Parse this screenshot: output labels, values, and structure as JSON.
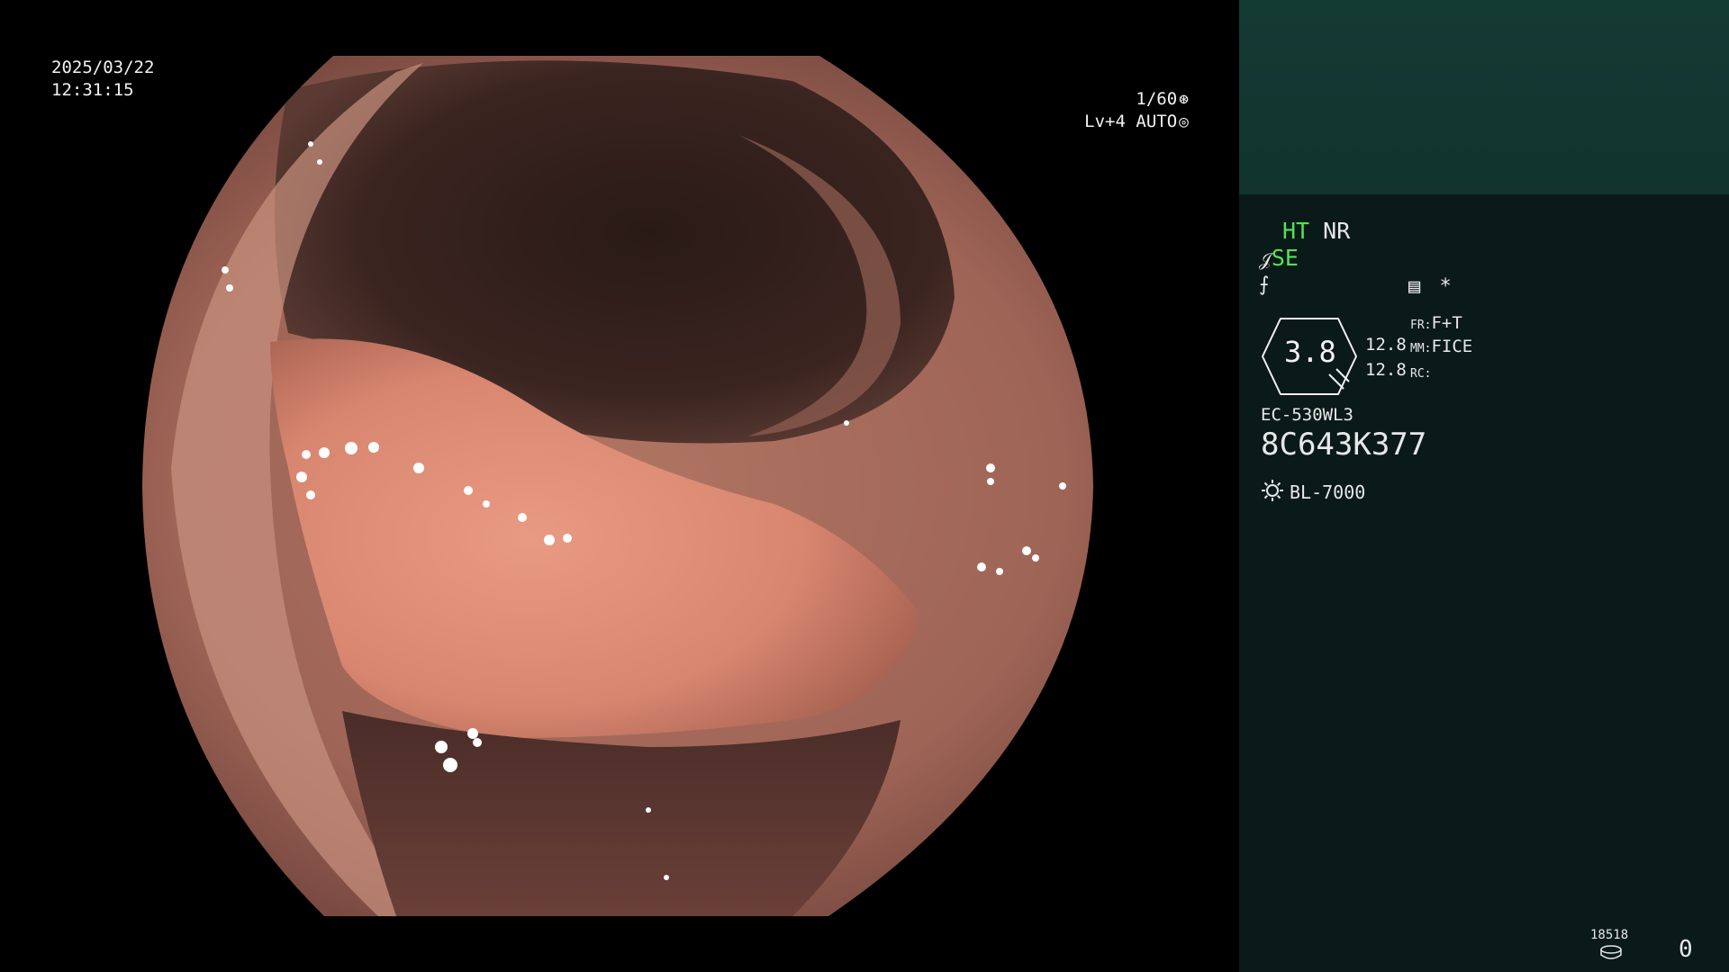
{
  "osd": {
    "date": "2025/03/22",
    "time": "12:31:15",
    "shutter": "1/60",
    "shutter_icon": "aperture-icon",
    "level": "Lv+4",
    "auto": "AUTO",
    "auto_icon": "iris-icon"
  },
  "panel": {
    "ht": "HT",
    "nr": "NR",
    "se": "SE",
    "se_icon": "structure-enhance-icon",
    "fe_icon": "color-enhance-icon",
    "list_icon": "list-icon",
    "star": "*",
    "zoom": "3.8",
    "val_a": "12.8",
    "val_b": "12.8",
    "fr_label": "FR:",
    "fr_value": "F+T",
    "mm_label": "MM:",
    "mm_value": "FICE",
    "rc_label": "RC:",
    "scope_model": "EC-530WL3",
    "scope_serial": "8C643K377",
    "light_source": "BL-7000",
    "light_icon": "sun-icon",
    "storage_count": "18518",
    "storage_icon": "disc-icon",
    "capture_count": "0"
  },
  "colors": {
    "highlight_green": "#58e05a",
    "panel_bg": "#0a1a18",
    "thumb_bg": "#143a34"
  }
}
